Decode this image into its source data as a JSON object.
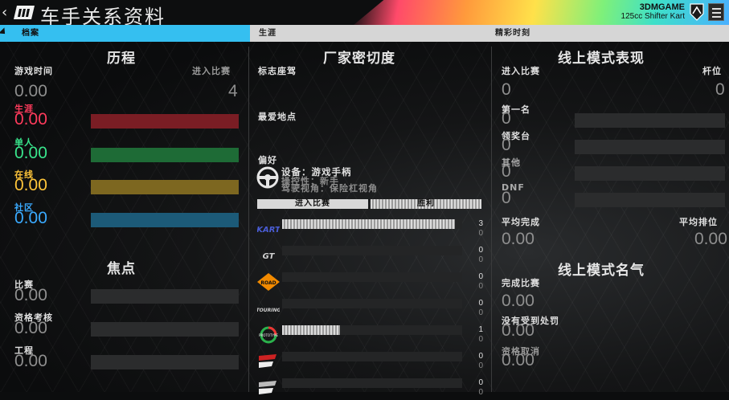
{
  "header": {
    "title": "车手关系资料",
    "game_name": "3DMGAME",
    "car_name": "125cc Shifter Kart"
  },
  "tabs": [
    {
      "label": "档案",
      "active": true
    },
    {
      "label": "生涯",
      "active": false
    },
    {
      "label": "精彩时刻",
      "active": false
    }
  ],
  "career": {
    "heading": "历程",
    "playtime_label": "游戏时间",
    "playtime_value": "0.00",
    "races_label": "进入比赛",
    "races_value": "4",
    "modes": [
      {
        "label": "生涯",
        "value": "0.00",
        "color": "#ff3b5c",
        "fill_color": "#7a1d24",
        "fraction": 1.0
      },
      {
        "label": "单人",
        "value": "0.00",
        "color": "#39e58c",
        "fill_color": "#1e6b36",
        "fraction": 1.0
      },
      {
        "label": "在线",
        "value": "0.00",
        "color": "#ffc53a",
        "fill_color": "#7d6720",
        "fraction": 1.0
      },
      {
        "label": "社区",
        "value": "0.00",
        "color": "#3aaaff",
        "fill_color": "#1c5a78",
        "fraction": 1.0
      }
    ]
  },
  "focus": {
    "heading": "焦点",
    "items": [
      {
        "label": "比赛",
        "value": "0.00"
      },
      {
        "label": "资格考核",
        "value": "0.00"
      },
      {
        "label": "工程",
        "value": "0.00"
      }
    ]
  },
  "manufacturer": {
    "heading": "厂家密切度",
    "signature_label": "标志座驾",
    "fav_place_label": "最爱地点",
    "pref_label": "偏好",
    "device_label": "设备：游戏手柄",
    "overlap_line_1": "操控性：新手",
    "overlap_line_2": "驾驶视角：保险杠视角",
    "col_races": "进入比赛",
    "col_wins": "胜利",
    "rows": [
      {
        "icon": "kart-logo-icon",
        "logo_text": "KART",
        "races": "3",
        "wins": "0",
        "fraction": 0.96
      },
      {
        "icon": "gt-logo-icon",
        "logo_text": "GT",
        "races": "0",
        "wins": "0",
        "fraction": 0
      },
      {
        "icon": "road-logo-icon",
        "logo_text": "ROAD",
        "races": "0",
        "wins": "0",
        "fraction": 0
      },
      {
        "icon": "touring-logo-icon",
        "logo_text": "TOURING",
        "races": "0",
        "wins": "0",
        "fraction": 0
      },
      {
        "icon": "prototype-logo-icon",
        "logo_text": "PROTOTYPE",
        "races": "1",
        "wins": "0",
        "fraction": 0.32
      },
      {
        "icon": "formula-logo-icon",
        "logo_text": "",
        "races": "0",
        "wins": "0",
        "fraction": 0
      },
      {
        "icon": "openwheel-logo-icon",
        "logo_text": "",
        "races": "0",
        "wins": "0",
        "fraction": 0
      }
    ]
  },
  "online": {
    "heading": "线上模式表现",
    "races_label": "进入比赛",
    "races_value": "0",
    "poles_label": "杆位",
    "poles_value": "0",
    "places": [
      {
        "label": "第一名",
        "value": "0"
      },
      {
        "label": "领奖台",
        "value": "0"
      },
      {
        "label": "其他",
        "value": "0"
      },
      {
        "label": "DNF",
        "value": "0"
      }
    ],
    "avg_finish_label": "平均完成",
    "avg_finish_value": "0.00",
    "avg_rank_label": "平均排位",
    "avg_rank_value": "0.00"
  },
  "reputation": {
    "heading": "线上模式名气",
    "completed_label": "完成比赛",
    "completed_value": "0.00",
    "penalty_label": "没有受到处罚",
    "penalty_value": "0.00",
    "dq_label": "资格取消",
    "dq_value": "0.00"
  }
}
